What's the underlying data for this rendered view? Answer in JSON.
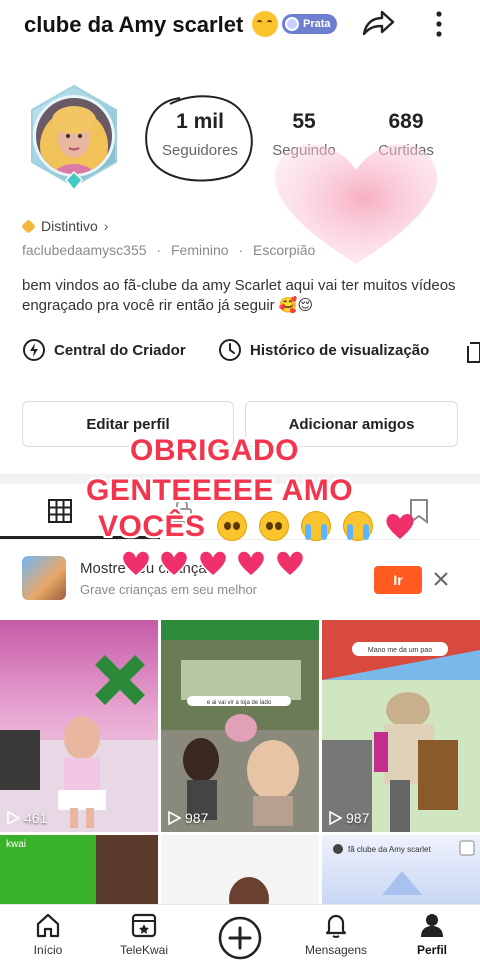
{
  "header": {
    "title": "clube da Amy scarlet",
    "badge": "Prata",
    "icons": [
      "share-icon",
      "more-icon"
    ]
  },
  "profile": {
    "stats": [
      {
        "value": "1 mil",
        "label": "Seguidores"
      },
      {
        "value": "55",
        "label": "Seguindo"
      },
      {
        "value": "689",
        "label": "Curtidas"
      }
    ],
    "badge_label": "Distintivo",
    "username": "faclubedaamysc355",
    "gender": "Feminino",
    "sign": "Escorpião",
    "meta_sep": "·",
    "bio": "bem vindos ao fã-clube da amy Scarlet aqui vai ter muitos vídeos engraçado pra você rir então já seguir 🥰😌"
  },
  "shortcuts": [
    {
      "label": "Central do Criador",
      "icon": "creator-center-icon"
    },
    {
      "label": "Histórico de visualização",
      "icon": "history-clock-icon"
    }
  ],
  "actions": {
    "edit_profile": "Editar perfil",
    "add_friends": "Adicionar amigos"
  },
  "overlay": {
    "line1": "OBRIGADO",
    "line2": "GENTEEEEE AMO",
    "line3": "VOCÊS"
  },
  "promo": {
    "title": "Mostre seu criança",
    "subtitle": "Grave crianças em seu melhor",
    "button": "Ir"
  },
  "videos": [
    {
      "plays": "461"
    },
    {
      "plays": "987",
      "caption": "e ai vai vir a loja de lado"
    },
    {
      "plays": "987",
      "caption": "Mano me da um pao"
    },
    {
      "caption": "kwai"
    },
    {},
    {
      "caption": "fã clube da Amy scarlet"
    }
  ],
  "bottom_nav": [
    {
      "label": "Início",
      "icon": "home-icon"
    },
    {
      "label": "TeleKwai",
      "icon": "telekwai-icon"
    },
    {
      "label": "",
      "icon": "create-plus-icon"
    },
    {
      "label": "Mensagens",
      "icon": "bell-icon"
    },
    {
      "label": "Perfil",
      "icon": "profile-icon",
      "active": true
    }
  ],
  "colors": {
    "accent": "#ff5a1f",
    "overlay_text": "#f2354d",
    "badge": "#6f7fd0"
  }
}
